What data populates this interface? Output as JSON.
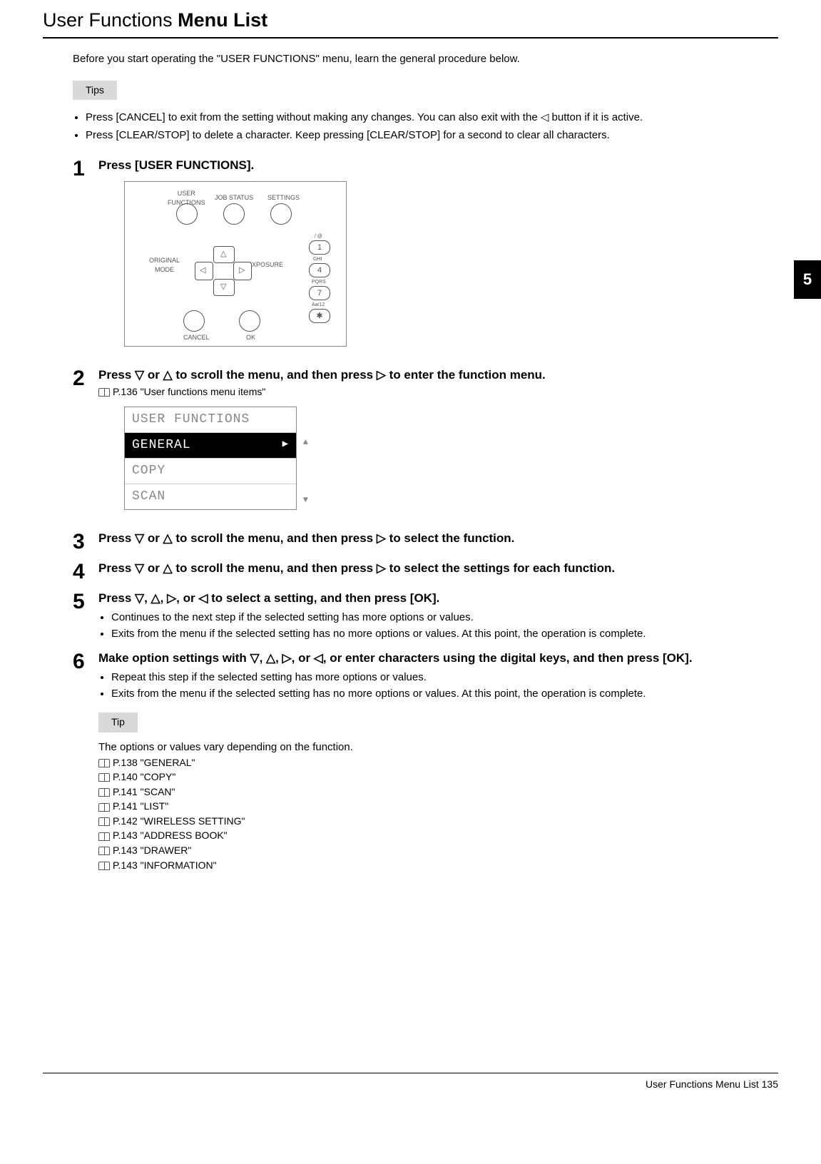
{
  "title_part1": "User Functions",
  "title_part2": "Menu List",
  "intro": "Before you start operating the \"USER FUNCTIONS\" menu, learn the general procedure below.",
  "tips_label": "Tips",
  "tips_bullets": [
    "Press [CANCEL] to exit from the setting without making any changes. You can also exit with the ◁ button if it is active.",
    "Press [CLEAR/STOP] to delete a character. Keep pressing [CLEAR/STOP] for a second to clear all characters."
  ],
  "steps": {
    "s1": {
      "num": "1",
      "heading": "Press [USER FUNCTIONS]."
    },
    "s2": {
      "num": "2",
      "heading": "Press ▽ or △ to scroll the menu, and then press ▷ to enter the function menu.",
      "ref": "P.136 \"User functions menu items\""
    },
    "s3": {
      "num": "3",
      "heading": "Press ▽ or △ to scroll the menu, and then press ▷ to select the function."
    },
    "s4": {
      "num": "4",
      "heading": "Press ▽ or △ to scroll the menu, and then press ▷ to select the settings for each function."
    },
    "s5": {
      "num": "5",
      "heading": "Press ▽, △, ▷, or ◁ to select a setting, and then press [OK].",
      "bullets": [
        "Continues to the next step if the selected setting has more options or values.",
        "Exits from the menu if the selected setting has no more options or values. At this point, the operation is complete."
      ]
    },
    "s6": {
      "num": "6",
      "heading": "Make option settings with ▽, △, ▷, or ◁, or enter characters using the digital keys, and then press [OK].",
      "bullets": [
        "Repeat this step if the selected setting has more options or values.",
        "Exits from the menu if the selected setting has no more options or values. At this point, the operation is complete."
      ]
    }
  },
  "tip_label": "Tip",
  "tip_intro": "The options or values vary depending on the function.",
  "tip_refs": [
    "P.138 \"GENERAL\"",
    "P.140 \"COPY\"",
    "P.141 \"SCAN\"",
    "P.141 \"LIST\"",
    "P.142 \"WIRELESS SETTING\"",
    "P.143 \"ADDRESS BOOK\"",
    "P.143 \"DRAWER\"",
    "P.143 \"INFORMATION\""
  ],
  "panel_labels": {
    "user_functions": "USER\nFUNCTIONS",
    "job_status": "JOB STATUS",
    "settings": "SETTINGS",
    "original_mode": "ORIGINAL\nMODE",
    "exposure": "EXPOSURE",
    "cancel": "CANCEL",
    "ok": "OK",
    "key1_sup": ". / @",
    "key1": "1",
    "key4_sup": "GHI",
    "key4": "4",
    "key7_sup": "PQRS",
    "key7": "7",
    "keystar_sup": "Aa/12",
    "keystar": "✱"
  },
  "lcd_menu": {
    "title": "USER FUNCTIONS",
    "items": [
      "GENERAL",
      "COPY",
      "SCAN"
    ]
  },
  "side_tab": "5",
  "footer": "User Functions Menu List    135"
}
